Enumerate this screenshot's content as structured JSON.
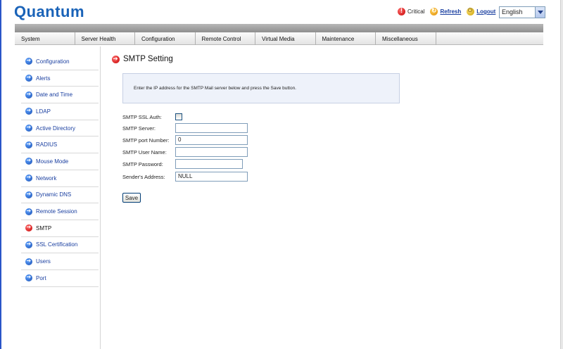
{
  "header": {
    "logo": "Quantum",
    "links": {
      "critical": "Critical",
      "refresh": "Refresh",
      "logout": "Logout"
    },
    "language": "English"
  },
  "nav": [
    "System",
    "Server Health",
    "Configuration",
    "Remote Control",
    "Virtual Media",
    "Maintenance",
    "Miscellaneous"
  ],
  "sidebar": {
    "items": [
      {
        "label": "Configuration",
        "icon": "blue-arrow-icon",
        "active": false
      },
      {
        "label": "Alerts",
        "icon": "blue-arrow-icon",
        "active": false
      },
      {
        "label": "Date and Time",
        "icon": "blue-arrow-icon",
        "active": false
      },
      {
        "label": "LDAP",
        "icon": "blue-arrow-icon",
        "active": false
      },
      {
        "label": "Active Directory",
        "icon": "blue-arrow-icon",
        "active": false
      },
      {
        "label": "RADIUS",
        "icon": "blue-arrow-icon",
        "active": false
      },
      {
        "label": "Mouse Mode",
        "icon": "blue-arrow-icon",
        "active": false
      },
      {
        "label": "Network",
        "icon": "blue-arrow-icon",
        "active": false
      },
      {
        "label": "Dynamic DNS",
        "icon": "blue-arrow-icon",
        "active": false
      },
      {
        "label": "Remote Session",
        "icon": "blue-arrow-icon",
        "active": false
      },
      {
        "label": "SMTP",
        "icon": "red-arrow-icon",
        "active": true
      },
      {
        "label": "SSL Certification",
        "icon": "blue-arrow-icon",
        "active": false
      },
      {
        "label": "Users",
        "icon": "blue-arrow-icon",
        "active": false
      },
      {
        "label": "Port",
        "icon": "blue-arrow-icon",
        "active": false
      }
    ]
  },
  "main": {
    "title": "SMTP Setting",
    "info": "Enter the IP address for the SMTP Mail server below and press the Save button.",
    "form": {
      "ssl_auth_label": "SMTP SSL Auth:",
      "ssl_auth_checked": false,
      "server_label": "SMTP Server:",
      "server_value": "",
      "port_label": "SMTP port Number:",
      "port_value": "0",
      "username_label": "SMTP User Name:",
      "username_value": "",
      "password_label": "SMTP Password:",
      "password_value": "",
      "sender_label": "Sender's Address:",
      "sender_value": "NULL"
    },
    "save_label": "Save"
  },
  "colors": {
    "brand": "#1a63b8",
    "link": "#1a3fa0",
    "info_box_bg": "#eef2fa"
  }
}
